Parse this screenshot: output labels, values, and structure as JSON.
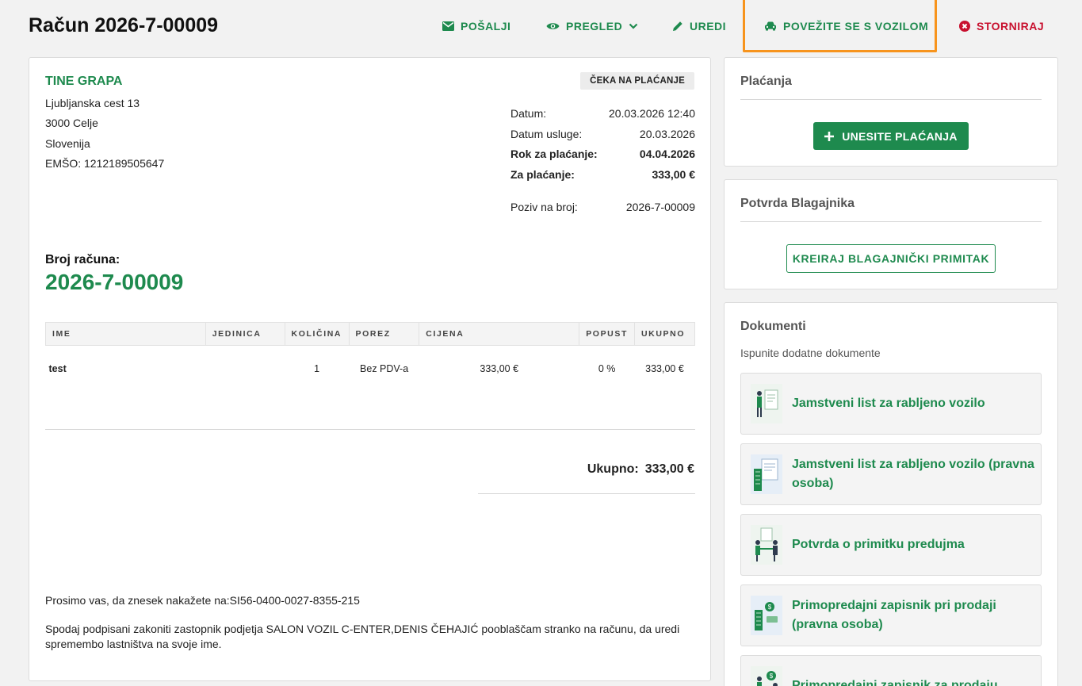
{
  "page": {
    "title": "Račun 2026-7-00009"
  },
  "toolbar": {
    "send": "POŠALJI",
    "preview": "PREGLED",
    "edit": "UREDI",
    "link_vehicle": "POVEŽITE SE S VOZILOM",
    "cancel": "STORNIRAJ"
  },
  "colors": {
    "accent": "#1e8a4e",
    "danger": "#c8102e",
    "highlight": "#f7941d"
  },
  "invoice": {
    "customer": {
      "name": "TINE GRAPA",
      "address": "Ljubljanska cest 13",
      "city": "3000 Celje",
      "country": "Slovenija",
      "emso": "EMŠO: 1212189505647"
    },
    "status": "ČEKA NA PLAĆANJE",
    "meta": [
      {
        "label": "Datum:",
        "value": "20.03.2026 12:40"
      },
      {
        "label": "Datum usluge:",
        "value": "20.03.2026"
      },
      {
        "label": "Rok za plaćanje:",
        "value": "04.04.2026"
      },
      {
        "label": "Za plaćanje:",
        "value": "333,00 €"
      },
      {
        "label": "Poziv na broj:",
        "value": "2026-7-00009"
      }
    ],
    "number_label": "Broj računa:",
    "number": "2026-7-00009",
    "columns": [
      "IME",
      "JEDINICA",
      "KOLIČINA",
      "POREZ",
      "CIJENA",
      "POPUST",
      "UKUPNO"
    ],
    "rows": [
      {
        "name": "test",
        "unit": "",
        "qty": "1",
        "tax": "Bez PDV-a",
        "price": "333,00 €",
        "discount": "0 %",
        "total": "333,00 €"
      }
    ],
    "total_label": "Ukupno:",
    "total_value": "333,00 €",
    "note_payment": "Prosimo vas, da znesek nakažete na:SI56-0400-0027-8355-215",
    "note_authorization": "Spodaj podpisani zakoniti zastopnik podjetja SALON VOZIL C-ENTER,DENIS ČEHAJIĆ pooblaščam stranko na računu, da uredi spremembo lastništva na svoje ime."
  },
  "payments": {
    "title": "Plaćanja",
    "button": "UNESITE PLAĆANJA"
  },
  "cashier": {
    "title": "Potvrda Blagajnika",
    "button": "KREIRAJ BLAGAJNIČKI PRIMITAK"
  },
  "documents": {
    "title": "Dokumenti",
    "subtitle": "Ispunite dodatne dokumente",
    "items": [
      {
        "label": "Jamstveni list za rabljeno vozilo",
        "icon": "document-person-icon"
      },
      {
        "label": "Jamstveni list za rabljeno vozilo (pravna osoba)",
        "icon": "document-building-icon"
      },
      {
        "label": "Potvrda o primitku predujma",
        "icon": "handshake-icon"
      },
      {
        "label": "Primopredajni zapisnik pri prodaji (pravna osoba)",
        "icon": "money-building-icon"
      },
      {
        "label": "Primopredajni zapisnik za prodaju",
        "icon": "money-person-icon"
      }
    ]
  }
}
